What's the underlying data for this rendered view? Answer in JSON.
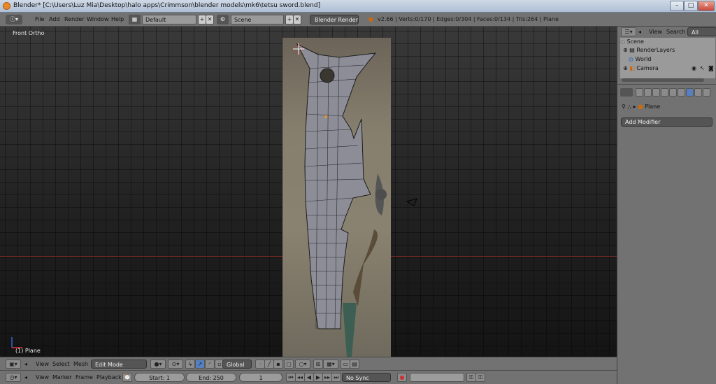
{
  "window": {
    "title": "Blender* [C:\\Users\\Luz Mia\\Desktop\\halo apps\\Crimmson\\blender models\\mk6\\tetsu sword.blend]",
    "minimize": "–",
    "maximize": "□",
    "close": "✕"
  },
  "topbar": {
    "menus": [
      "File",
      "Add",
      "Render",
      "Window",
      "Help"
    ],
    "screen_layout": "Default",
    "scene": "Scene",
    "render_engine": "Blender Render",
    "stats": "v2.66 | Verts:0/170 | Edges:0/304 | Faces:0/134 | Tris:264 | Plane",
    "plus": "+",
    "x": "✕"
  },
  "viewport": {
    "view_label": "Front Ortho",
    "object_label": "(1) Plane"
  },
  "view3d_header": {
    "menus": [
      "View",
      "Select",
      "Mesh"
    ],
    "mode": "Edit Mode",
    "orientation": "Global"
  },
  "timeline": {
    "menus": [
      "View",
      "Marker",
      "Frame",
      "Playback"
    ],
    "start": "Start: 1",
    "end": "End: 250",
    "current_frame": "1",
    "sync": "No Sync"
  },
  "outliner": {
    "menus": [
      "View",
      "Search"
    ],
    "filter": "All Scenes",
    "items": [
      "Scene",
      "RenderLayers",
      "World",
      "Camera"
    ]
  },
  "properties": {
    "breadcrumb_object": "Plane",
    "add_modifier": "Add Modifier"
  },
  "colors": {
    "accent_active": "#5680c2",
    "x_axis": "#7a2a2a",
    "mesh_face": "#8c8d97",
    "mesh_edge": "#1c1c1c"
  }
}
